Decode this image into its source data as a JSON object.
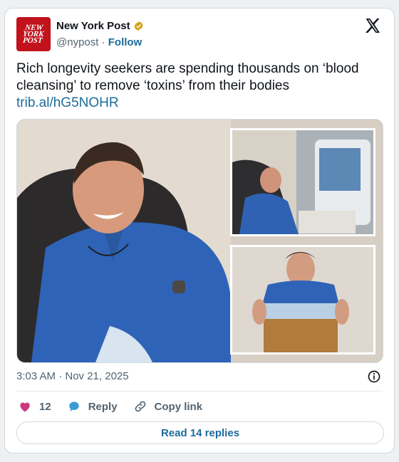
{
  "account": {
    "name": "New York Post",
    "handle": "@nypost",
    "separator": "·",
    "follow_label": "Follow",
    "logo_lines": [
      "NEW",
      "YORK",
      "POST"
    ]
  },
  "tweet": {
    "text": "Rich longevity seekers are spending thousands on ‘blood cleansing’ to remove ‘toxins’ from their bodies",
    "link": "trib.al/hG5NOHR"
  },
  "meta": {
    "timestamp": "3:03 AM · Nov 21, 2025"
  },
  "actions": {
    "likes": "12",
    "reply_label": "Reply",
    "copy_label": "Copy link"
  },
  "read_replies_label": "Read 14 replies",
  "icons": {
    "verified": "verified-badge-icon",
    "x": "x-logo-icon",
    "info": "info-icon",
    "heart": "heart-icon",
    "reply": "speech-bubble-icon",
    "link": "link-icon"
  },
  "colors": {
    "brand_red": "#c2121b",
    "link_blue": "#1d6b9b",
    "heart": "#c9377f",
    "reply_bubble": "#3a9bd6",
    "verified_gold": "#d3a41a"
  }
}
